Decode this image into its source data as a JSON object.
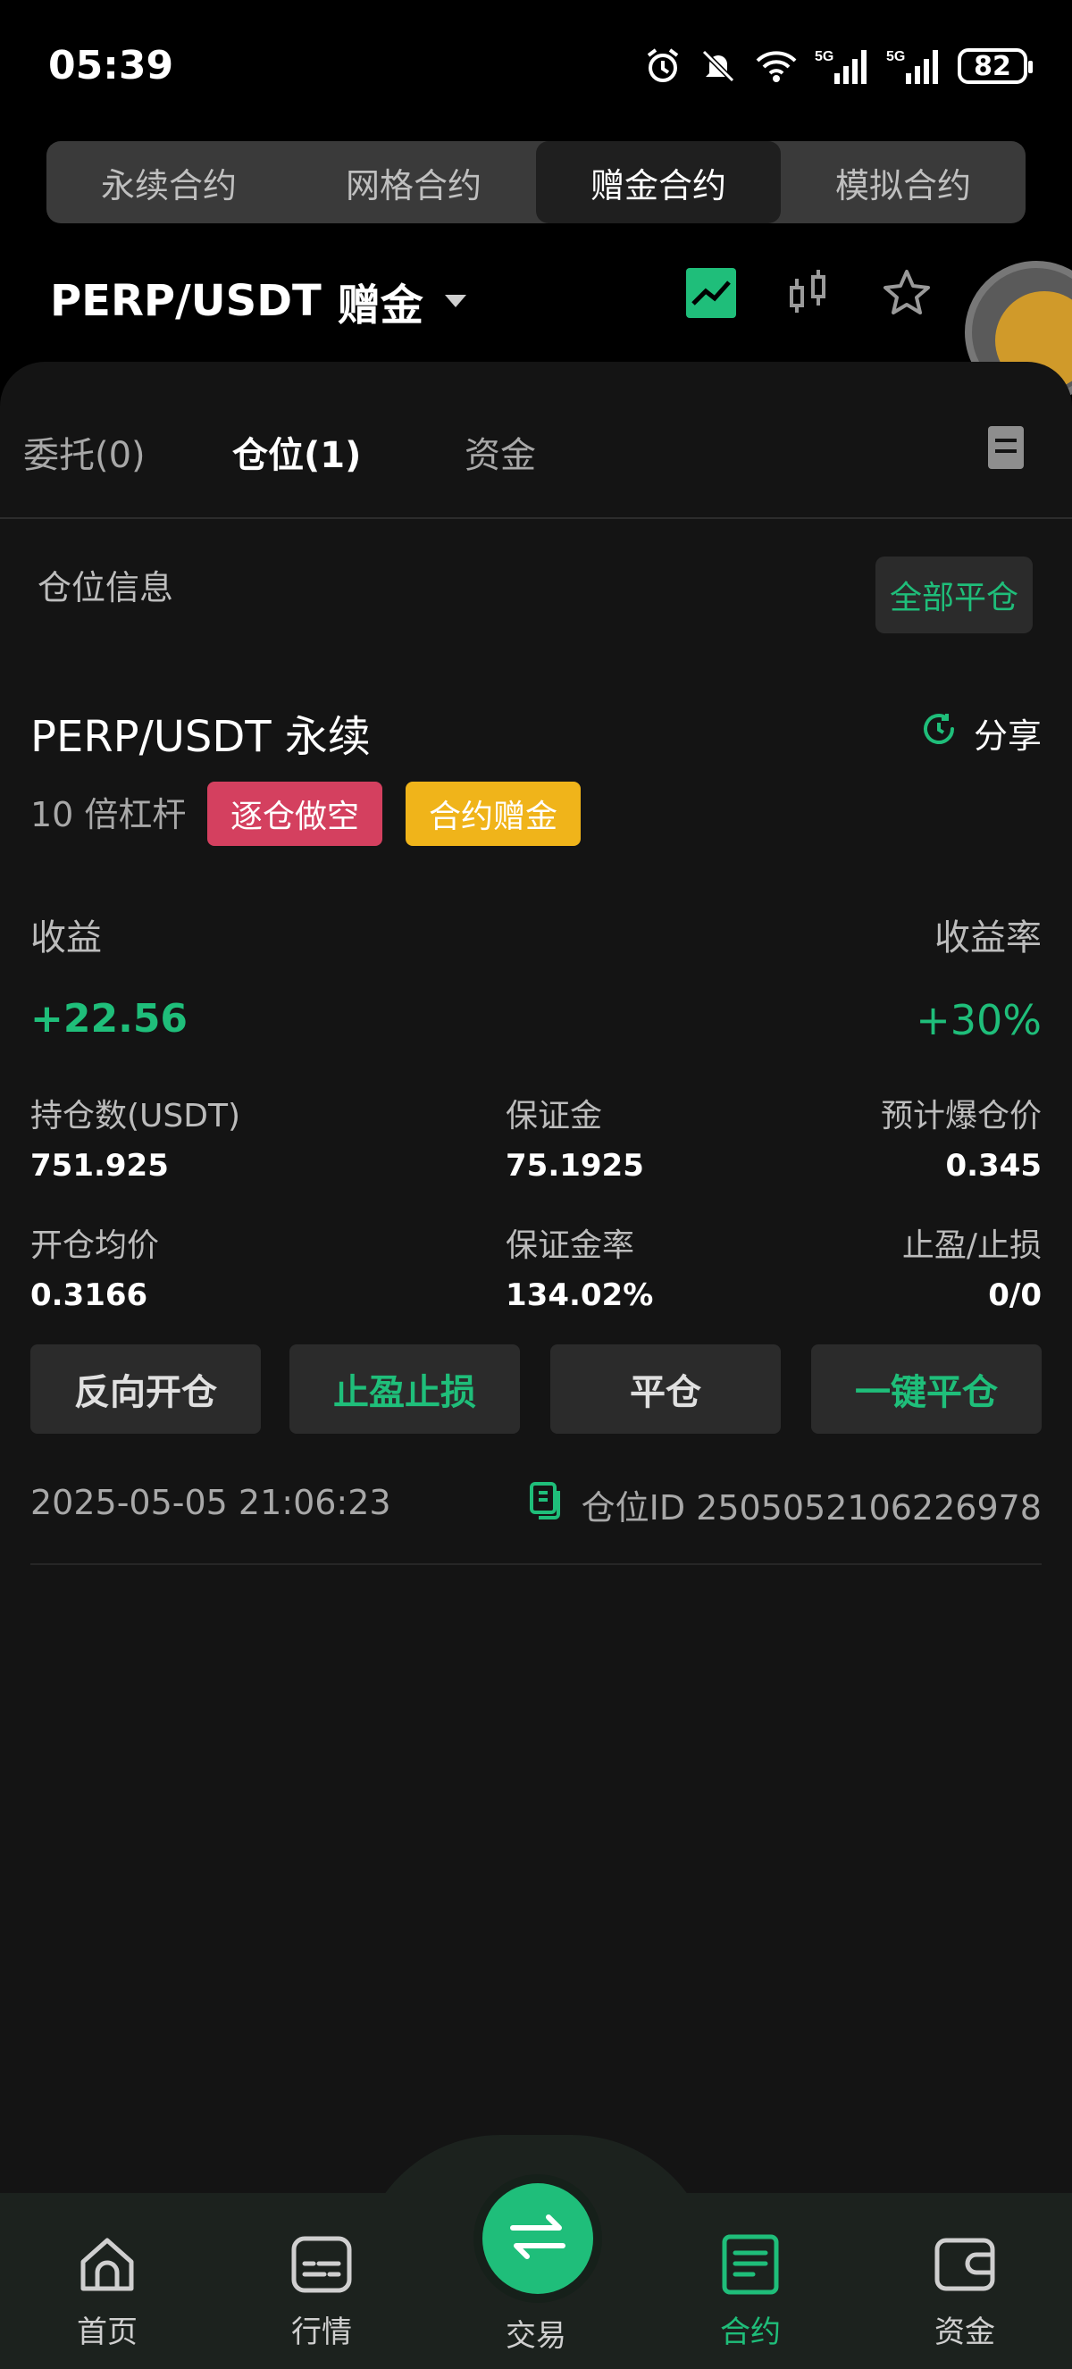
{
  "status_bar": {
    "time": "05:39",
    "battery": "82",
    "signal_label_1": "5G",
    "signal_label_2": "5G"
  },
  "contract_tabs": [
    {
      "label": "永续合约",
      "active": false
    },
    {
      "label": "网格合约",
      "active": false
    },
    {
      "label": "赠金合约",
      "active": true
    },
    {
      "label": "模拟合约",
      "active": false
    }
  ],
  "pair": {
    "symbol": "PERP/USDT",
    "tag": "赠金"
  },
  "sub_tabs": {
    "orders": "委托(0)",
    "positions": "仓位(1)",
    "funds": "资金"
  },
  "position_section": {
    "title": "仓位信息",
    "close_all": "全部平仓"
  },
  "position": {
    "name": "PERP/USDT 永续",
    "share": "分享",
    "leverage": "10 倍杠杆",
    "side_badge": "逐仓做空",
    "bonus_badge": "合约赠金",
    "pnl_label": "收益",
    "pnl_rate_label": "收益率",
    "pnl_value": "+22.56",
    "pnl_rate_value": "+30%",
    "size_label": "持仓数(USDT)",
    "size_value": "751.925",
    "margin_label": "保证金",
    "margin_value": "75.1925",
    "liq_label": "预计爆仓价",
    "liq_value": "0.345",
    "entry_label": "开仓均价",
    "entry_value": "0.3166",
    "margin_rate_label": "保证金率",
    "margin_rate_value": "134.02%",
    "tpsl_label": "止盈/止损",
    "tpsl_value": "0/0",
    "timestamp": "2025-05-05 21:06:23",
    "position_id": "仓位ID 2505052106226978"
  },
  "actions": {
    "reverse": "反向开仓",
    "tpsl": "止盈止损",
    "close": "平仓",
    "quick_close": "一键平仓"
  },
  "bottom_nav": {
    "home": "首页",
    "market": "行情",
    "trade": "交易",
    "contract": "合约",
    "assets": "资金"
  },
  "colors": {
    "accent_green": "#1fbe7a",
    "short_red": "#d4405f",
    "bonus_yellow": "#f0b41a"
  }
}
